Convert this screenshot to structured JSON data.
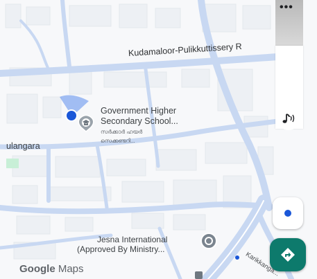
{
  "map": {
    "road_name": "Kudamaloor-Pulikkuttissery R",
    "places": [
      {
        "name": "Government Higher Secondary School...",
        "name_line1": "Government Higher",
        "name_line2": "Secondary School...",
        "local_name_line1": "സർക്കാർ ഹയർ",
        "local_name_line2": "സെക്കണ്ടറി..."
      },
      {
        "name_line1": "Jesna International",
        "name_line2": "(Approved By Ministry..."
      }
    ],
    "area_label": "ulangara",
    "street_label": "Karikkanga...",
    "logo_google": "Google",
    "logo_maps": "Maps"
  },
  "icons": {
    "more": "more-dots-icon",
    "sound": "sound-icon",
    "recenter": "location-dot-icon",
    "directions": "directions-icon",
    "school": "school-pin-icon",
    "place": "place-pin-icon"
  },
  "colors": {
    "road": "#c8d8f2",
    "block": "#eef1f5",
    "location": "#1a57d8",
    "directions": "#0d7a6c",
    "grass": "#c8efd7"
  }
}
